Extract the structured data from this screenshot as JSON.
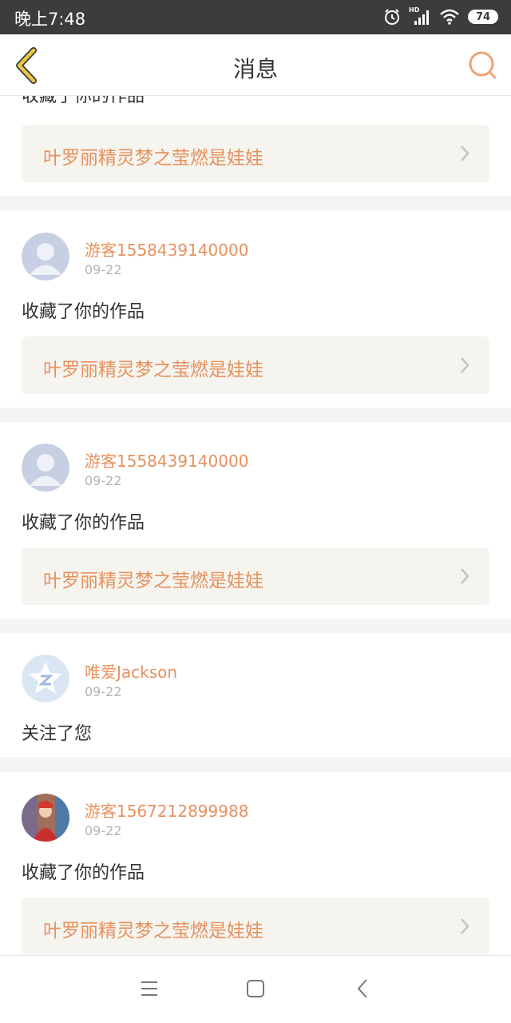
{
  "status_bar": {
    "time": "晚上7:48",
    "hd_label": "HD",
    "battery": "74"
  },
  "header": {
    "title": "消息"
  },
  "top_partial": {
    "action_text": "收藏了你的作品",
    "work_title": "叶罗丽精灵梦之莹燃是娃娃"
  },
  "messages": [
    {
      "username": "游客1558439140000",
      "date": "09-22",
      "action_text": "收藏了你的作品",
      "work_title": "叶罗丽精灵梦之莹燃是娃娃"
    },
    {
      "username": "游客1558439140000",
      "date": "09-22",
      "action_text": "收藏了你的作品",
      "work_title": "叶罗丽精灵梦之莹燃是娃娃"
    },
    {
      "username": "唯爱Jackson",
      "date": "09-22",
      "action_text": "关注了您"
    },
    {
      "username": "游客1567212899988",
      "date": "09-22",
      "action_text": "收藏了你的作品",
      "work_title": "叶罗丽精灵梦之莹燃是娃娃"
    }
  ],
  "colors": {
    "accent": "#e6915e",
    "back_arrow": "#e8c845",
    "card_background": "#f5f4ee",
    "status_bar": "#3c3c3c"
  },
  "icons": {
    "back": "chevron-left-icon",
    "search": "search-icon",
    "menu": "menu-icon",
    "home": "square-icon",
    "nav_back": "chevron-left-icon"
  }
}
